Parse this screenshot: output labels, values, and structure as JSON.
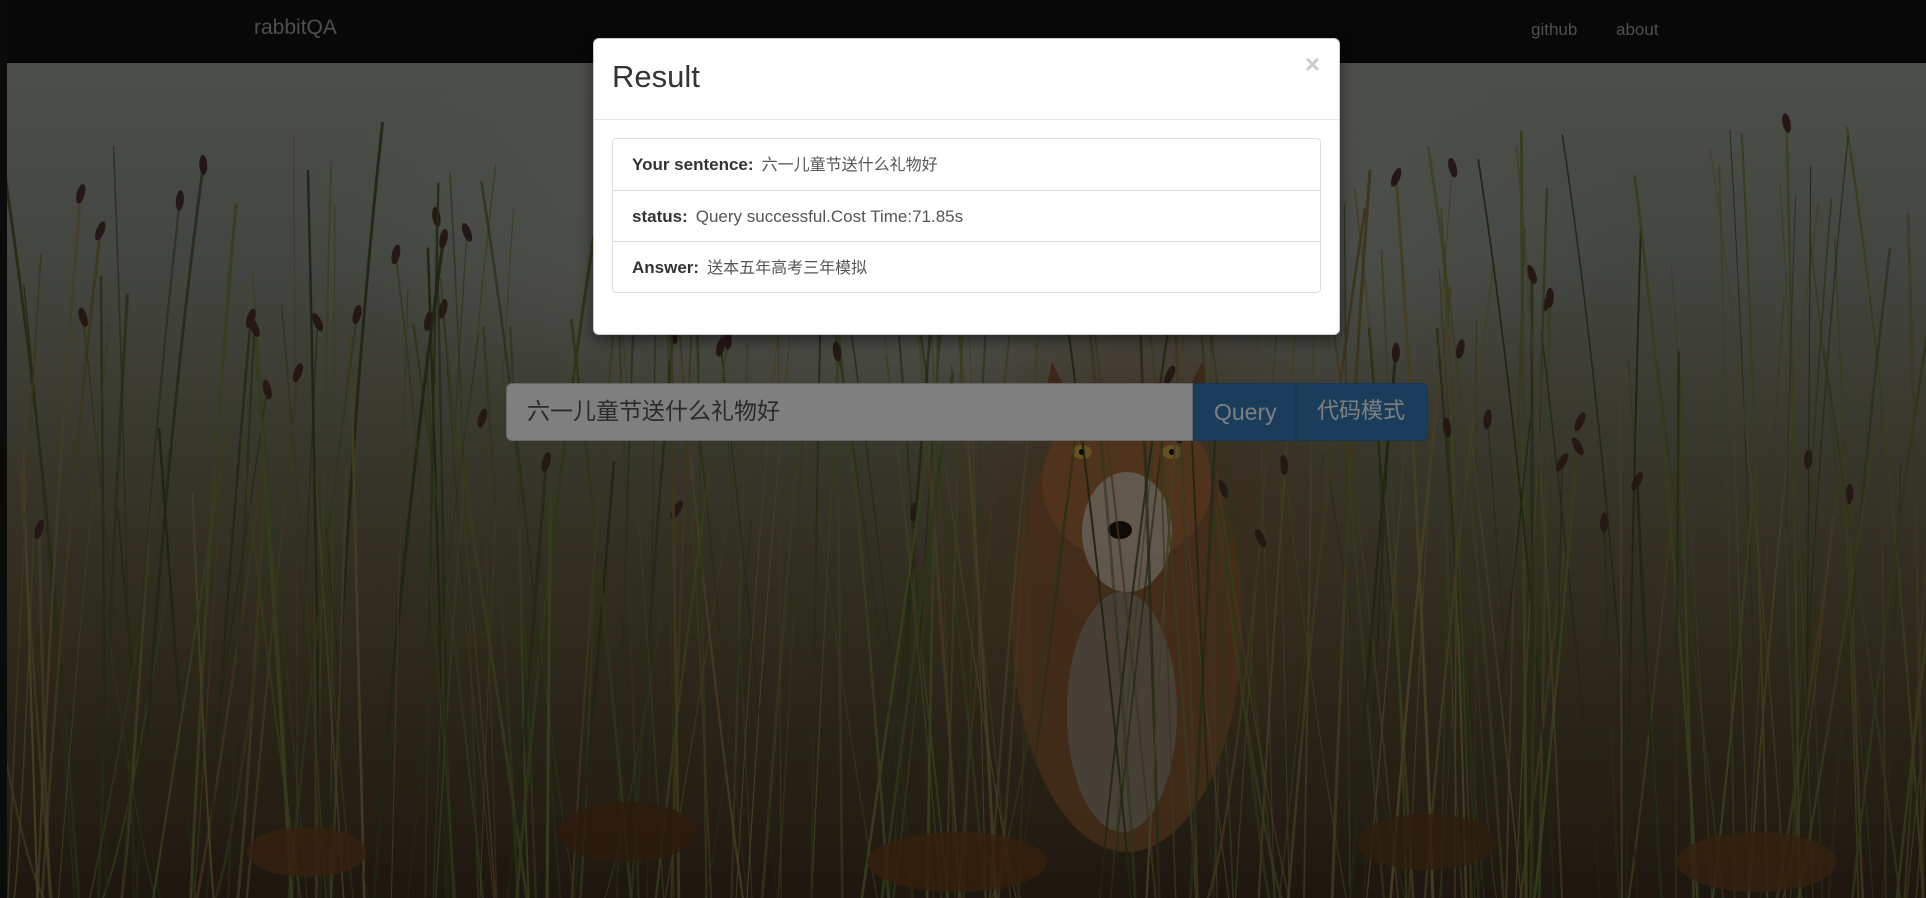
{
  "navbar": {
    "brand": "rabbitQA",
    "links": [
      "github",
      "about"
    ]
  },
  "search": {
    "value": "六一儿童节送什么礼物好",
    "query_label": "Query",
    "code_mode_label": "代码模式"
  },
  "modal": {
    "title": "Result",
    "close_glyph": "×",
    "rows": [
      {
        "label": "Your sentence:",
        "value": "六一儿童节送什么礼物好"
      },
      {
        "label": "status:",
        "value": "Query successful.Cost Time:71.85s"
      },
      {
        "label": "Answer:",
        "value": "送本五年高考三年模拟"
      }
    ]
  },
  "colors": {
    "navbar_bg": "#101010",
    "nav_text": "#9d9d9d",
    "primary_button": "#337ab7"
  }
}
